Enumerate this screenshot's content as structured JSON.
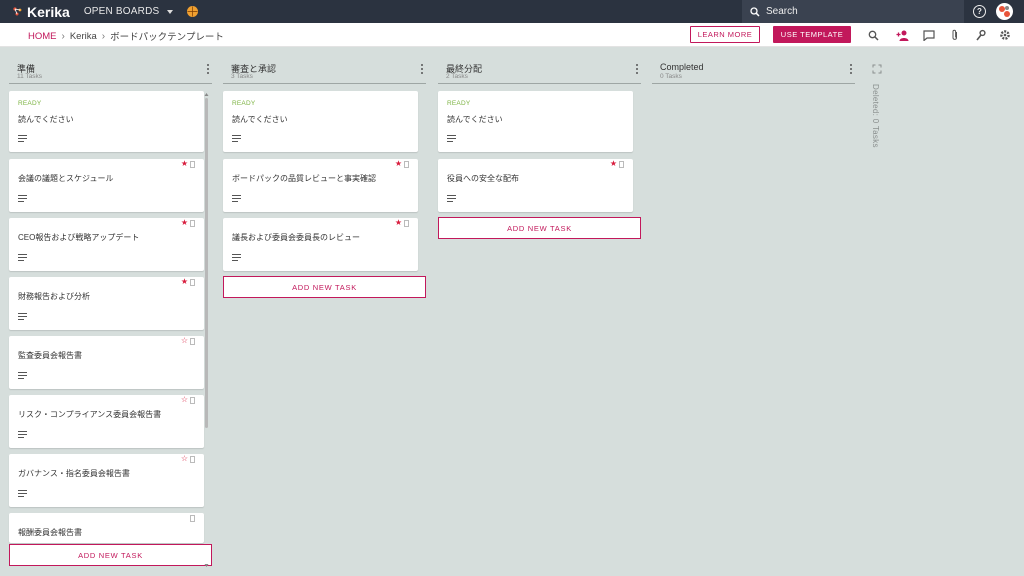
{
  "topbar": {
    "logo_text": "Kerika",
    "open_boards": "OPEN BOARDS",
    "search_placeholder": "Search"
  },
  "breadcrumb": {
    "home": "HOME",
    "account": "Kerika",
    "board": "ボードパックテンプレート"
  },
  "actions": {
    "learn_more": "LEARN MORE",
    "use_template": "USE TEMPLATE"
  },
  "columns": [
    {
      "title": "準備",
      "count": "11 Tasks",
      "cards": [
        {
          "status": "READY",
          "title": "読んでください"
        },
        {
          "title": "会議の議題とスケジュール",
          "star": "filled"
        },
        {
          "title": "CEO報告および戦略アップデート",
          "star": "filled"
        },
        {
          "title": "財務報告および分析",
          "star": "filled"
        },
        {
          "title": "監査委員会報告書",
          "star": "outline"
        },
        {
          "title": "リスク・コンプライアンス委員会報告書",
          "star": "outline"
        },
        {
          "title": "ガバナンス・指名委員会報告書",
          "star": "outline"
        },
        {
          "title": "報酬委員会報告書"
        }
      ],
      "add_label": "ADD NEW TASK"
    },
    {
      "title": "審査と承認",
      "count": "3 Tasks",
      "cards": [
        {
          "status": "READY",
          "title": "読んでください"
        },
        {
          "title": "ボードパックの品質レビューと事実確認",
          "star": "filled"
        },
        {
          "title": "議長および委員会委員長のレビュー",
          "star": "filled"
        }
      ],
      "add_label": "ADD NEW TASK"
    },
    {
      "title": "最終分配",
      "count": "2 Tasks",
      "cards": [
        {
          "status": "READY",
          "title": "読んでください"
        },
        {
          "title": "役員への安全な配布",
          "star": "filled"
        }
      ],
      "add_label": "ADD NEW TASK"
    },
    {
      "title": "Completed",
      "count": "0 Tasks"
    }
  ],
  "deleted": {
    "label": "Deleted: 0 Tasks"
  },
  "colors": {
    "brand": "#c2185b",
    "topbar": "#2b3340",
    "ready": "#7cb342",
    "star": "#d81b3c",
    "board_bg": "#d6dedc"
  }
}
